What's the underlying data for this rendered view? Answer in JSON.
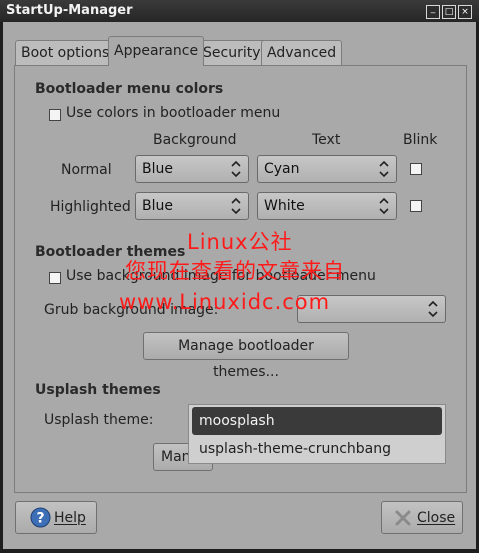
{
  "window": {
    "title": "StartUp-Manager",
    "controls": {
      "minimize": "_",
      "maximize": "□",
      "close": "×"
    }
  },
  "tabs": [
    {
      "label": "Boot options"
    },
    {
      "label": "Appearance"
    },
    {
      "label": "Security"
    },
    {
      "label": "Advanced"
    }
  ],
  "colors_section": {
    "heading": "Bootloader menu colors",
    "use_colors_label": "Use colors in bootloader menu",
    "col_background": "Background",
    "col_text": "Text",
    "col_blink": "Blink",
    "rows": [
      {
        "label": "Normal",
        "background": "Blue",
        "text": "Cyan"
      },
      {
        "label": "Highlighted",
        "background": "Blue",
        "text": "White"
      }
    ]
  },
  "themes_section": {
    "heading": "Bootloader themes",
    "use_bg_image_label": "Use background image for bootloader menu",
    "grub_bg_label": "Grub background image:",
    "grub_bg_value": "",
    "manage_button": "Manage bootloader themes..."
  },
  "usplash_section": {
    "heading": "Usplash themes",
    "theme_label": "Usplash theme:",
    "manage_button_partial": "Man",
    "options": [
      "moosplash",
      "usplash-theme-crunchbang"
    ]
  },
  "watermark": {
    "line1": "Linux公社",
    "line2": "您现在查看的文章来自",
    "line3": "www.Linuxidc.com"
  },
  "footer": {
    "help_label": "Help",
    "close_label": "Close"
  },
  "icons": {
    "help": "help-circle-icon",
    "close": "close-x-icon",
    "combo_arrow": "up-down-chevron-icon"
  },
  "colors": {
    "window_bg": "#a9a9a9",
    "titlebar_bg": "#2c2c2c",
    "selected_item_bg": "#3a3a3a",
    "watermark": "#ff1a1a"
  }
}
